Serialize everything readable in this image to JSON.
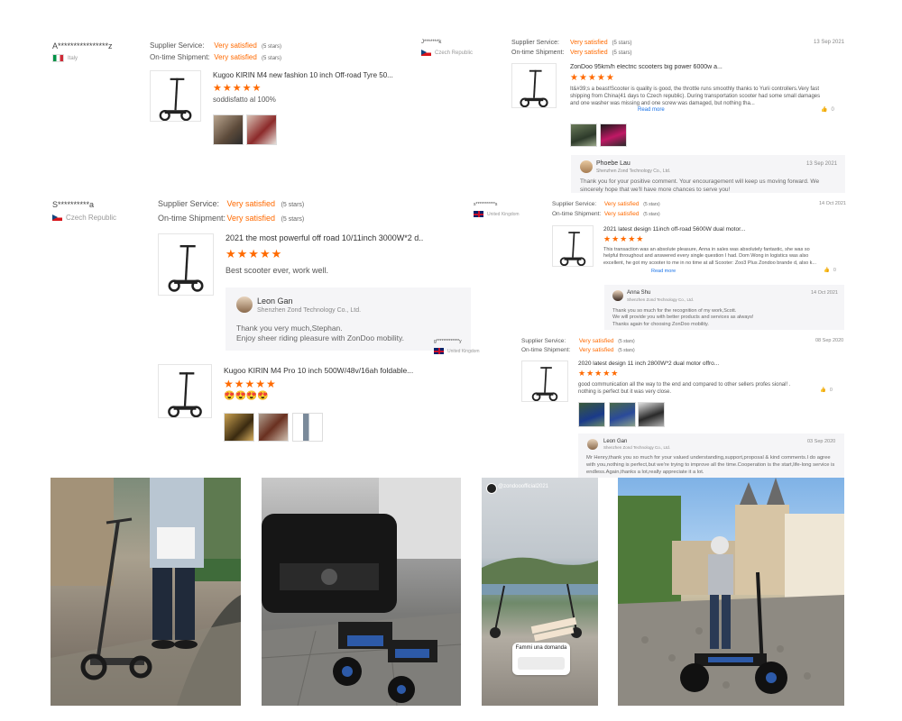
{
  "labels": {
    "supplier_service": "Supplier Service:",
    "ontime_shipment": "On-time Shipment:",
    "read_more": "Read more"
  },
  "reviews": [
    {
      "user": "A****************z",
      "country": "Italy",
      "supplier_value": "Very satisfied",
      "supplier_stars": "(5 stars)",
      "shipment_value": "Very satisfied",
      "shipment_stars": "(5 stars)",
      "product": "Kugoo KIRIN M4 new fashion 10 inch Off-road Tyre 50...",
      "stars": "★★★★★",
      "text": "soddisfatto  al 100%"
    },
    {
      "user": "J*******k",
      "country": "Czech Republic",
      "supplier_value": "Very satisfied",
      "supplier_stars": "(5 stars)",
      "shipment_value": "Very satisfied",
      "shipment_stars": "(5 stars)",
      "date": "13 Sep 2021",
      "product": "ZonDoo 95km/h electric scooters big power 6000w a...",
      "stars": "★★★★★",
      "text": "It&#39;s a beast!Scooter is quality is good, the throttle runs smoothly thanks to Yurii controllers.Very fast shipping from China(41 days to Czech republic). During transportation scooter had some small damages and one washer was missing and one screw was damaged, but nothing tha...",
      "likes": "0",
      "reply": {
        "name": "Phoebe Lau",
        "company": "Shenzhen Zond Technology Co., Ltd.",
        "date": "13 Sep 2021",
        "text": "Thank you for your positive comment. Your encouragement will keep us moving forward. We sincerely hope that we'll have more chances to serve you!"
      }
    },
    {
      "user": "S**********a",
      "country": "Czech Republic",
      "supplier_value": "Very satisfied",
      "supplier_stars": "(5 stars)",
      "shipment_value": "Very satisfied",
      "shipment_stars": "(5 stars)",
      "product": "2021 the most powerful off road 10/11inch 3000W*2 d...",
      "stars": "★★★★★",
      "text": "Best scooter ever, work well.",
      "reply": {
        "name": "Leon Gan",
        "company": "Shenzhen Zond Technology Co., Ltd.",
        "text": "Thank you very much,Stephan.\nEnjoy sheer riding pleasure with ZonDoo mobility."
      }
    },
    {
      "user": "s***********s",
      "country": "United Kingdom",
      "supplier_value": "Very satisfied",
      "supplier_stars": "(5 stars)",
      "shipment_value": "Very satisfied",
      "shipment_stars": "(5 stars)",
      "date": "14 Oct 2021",
      "product": "2021 latest design 11inch off-road 5600W dual motor...",
      "stars": "★★★★★",
      "text": "This transaction was an absolute pleasure, Anna in sales was absolutely fantastic, she was so helpful throughout and answered every single question I had. Dom Wong in logistics was also excellent, he got my scooter to me in no time at all Scooter: Zoo3 Plus Zondoo brande d, also k...",
      "likes": "0",
      "reply": {
        "name": "Anna Shu",
        "company": "Shenzhen Zond Technology Co., Ltd.",
        "date": "14 Oct 2021",
        "text": "Thank you so much for the recognition of my work,Scott.\nWe will provide you with better products and services as always!\nThanks again for choosing ZonDoo mobility."
      }
    },
    {
      "product": "Kugoo KIRIN M4 Pro 10 inch 500W/48v/16ah foldable...",
      "stars": "★★★★★",
      "text": "😍😍😍😍"
    },
    {
      "user": "g*************y",
      "country": "United Kingdom",
      "supplier_value": "Very satisfied",
      "supplier_stars": "(5 stars)",
      "shipment_value": "Very satisfied",
      "shipment_stars": "(5 stars)",
      "date": "08 Sep 2020",
      "product": "2020 latest design 11 inch 2800W*2 dual motor offro...",
      "stars": "★★★★★",
      "text": "good communication all the way to the end and compared to other sellers profes sional! . nothing is perfect but it was very close.",
      "likes": "0",
      "reply": {
        "name": "Leon Gan",
        "company": "Shenzhen Zond Technology Co., Ltd.",
        "date": "03 Sep 2020",
        "text": "Mr Henry,thank you so much for your valued understanding,support,proposal  & kind comments.I do agree with you,nothing is perfect,but we're trying to improve all the time.Cooperation is the start,life-long service is endless.Again,thanks a lot,really appreciate it a lot."
      }
    }
  ],
  "story": {
    "handle": "@zondooofficial2021",
    "question": "Fammi una domanda"
  },
  "colors": {
    "accent": "#ff6a00",
    "link": "#1a73e8",
    "reply_bg": "#f5f5f7"
  }
}
